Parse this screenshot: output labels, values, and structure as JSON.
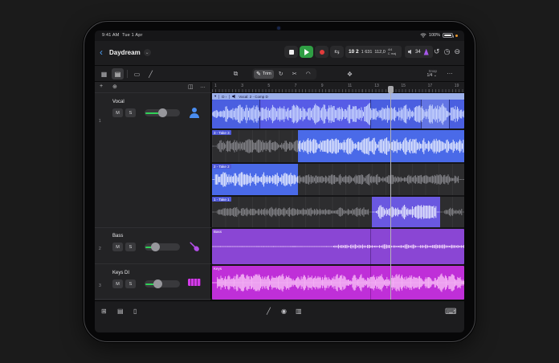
{
  "status": {
    "time": "9:41 AM",
    "date": "Tue 1 Apr",
    "battery": "100%"
  },
  "titlebar": {
    "back_glyph": "‹",
    "project_title": "Daydream",
    "lcd": {
      "position_main": "10 2",
      "position_sub": "1 631",
      "tempo": "112,0",
      "time_sig": "4/4",
      "key": "C maj"
    },
    "monitor_level": "34"
  },
  "toolbar": {
    "trim_label": "Trim",
    "snap_label": "Snap",
    "snap_value": "1/4"
  },
  "icons": {
    "chevron_down": "⌄",
    "cycle": "⇆",
    "undo": "↺",
    "history": "◷",
    "minus_circle": "⊖",
    "grid": "▦",
    "tracks_view": "▤",
    "region_view": "▭",
    "automation": "╱",
    "copy": "⧉",
    "pencil": "✎",
    "loop": "↻",
    "scissors": "✂",
    "fade": "◠",
    "stamp": "❖",
    "ellipsis": "…",
    "plus": "+",
    "add_track": "⊕",
    "columns": "◫",
    "browser": "⊞",
    "mixer": "▤",
    "fader": "▯",
    "edit": "╱",
    "knob": "◉",
    "piano": "▥",
    "keyboard": "⌨"
  },
  "ruler": {
    "numbers": [
      "1",
      "3",
      "5",
      "7",
      "9",
      "11",
      "13",
      "15",
      "17",
      "19"
    ]
  },
  "tracks": [
    {
      "number": "1",
      "name": "Vocal",
      "mute": "M",
      "solo": "S"
    },
    {
      "number": "2",
      "name": "Bass",
      "mute": "M",
      "solo": "S"
    },
    {
      "number": "3",
      "name": "Keys DI",
      "mute": "M",
      "solo": "S"
    }
  ],
  "regions": {
    "comp": {
      "disclosure": "▾",
      "meta": "D ›",
      "label": "Vocal: 2 - Comp D"
    },
    "take3": "3 - Take 3",
    "take2": "2 - Take 2",
    "take1": "1 - Take 1",
    "bass": "Bass",
    "keys": "Keys"
  },
  "colors": {
    "play_green": "#2f9e44",
    "record_red": "#e23c3c",
    "slider_green": "#30d158",
    "comp_blue": "#4a5fe0",
    "take_blue": "#4a6ae8",
    "take_purple": "#6a58e0",
    "bass_purple": "#8a46d4",
    "keys_magenta": "#bf2fd8",
    "metronome_purple": "#a557e8",
    "vocal_icon_blue": "#4a8df0",
    "mic_indicator_orange": "#e8972e"
  }
}
